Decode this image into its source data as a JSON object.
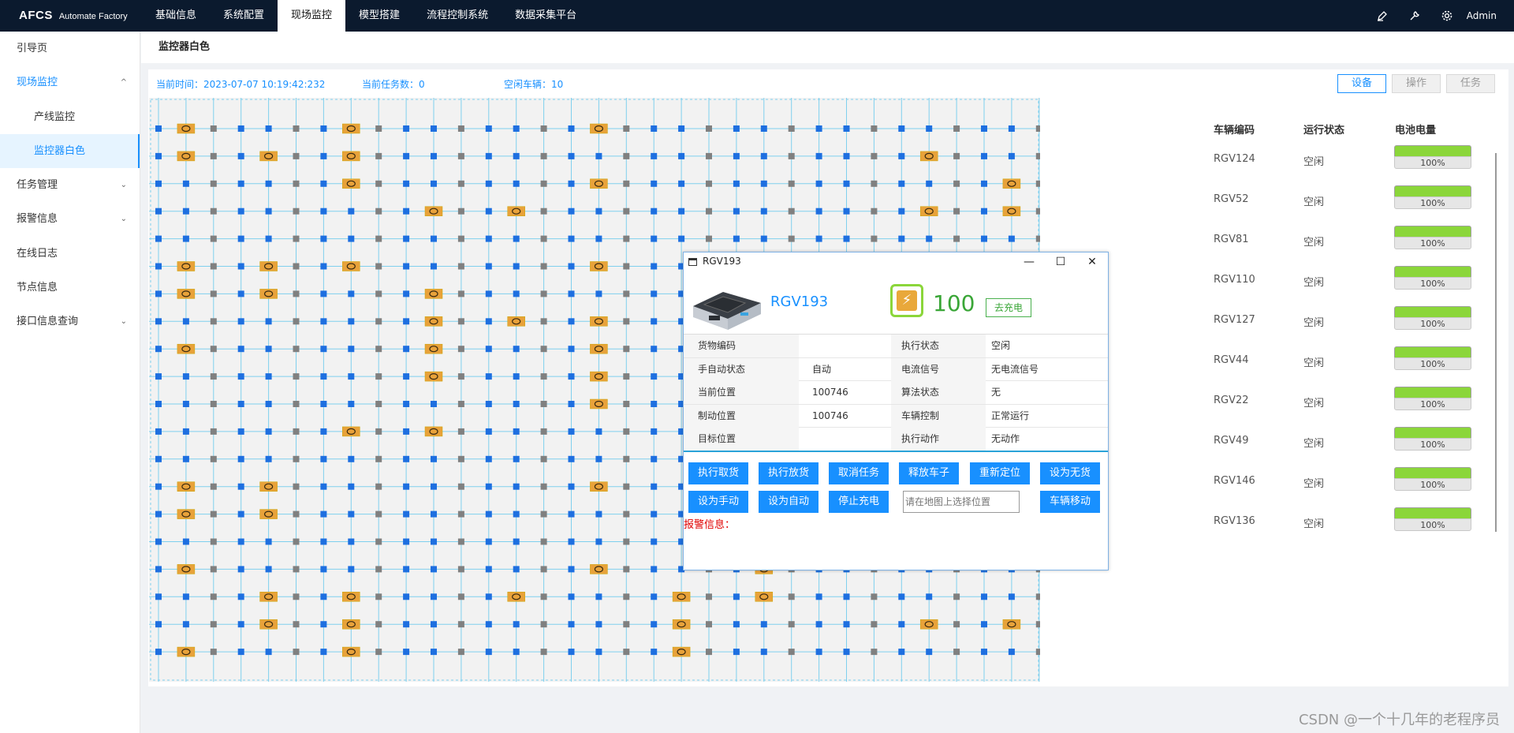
{
  "app": {
    "brand_bold": "AFCS",
    "brand_sub": "Automate Factory",
    "user": "Admin"
  },
  "topnav": [
    "基础信息",
    "系统配置",
    "现场监控",
    "模型搭建",
    "流程控制系统",
    "数据采集平台"
  ],
  "top_icons": [
    "pen-icon",
    "wrench-icon",
    "gear-icon"
  ],
  "sidebar": [
    {
      "label": "引导页"
    },
    {
      "label": "现场监控",
      "chev": "^"
    },
    {
      "label": "产线监控"
    },
    {
      "label": "监控器白色"
    },
    {
      "label": "任务管理",
      "chev": "⌄"
    },
    {
      "label": "报警信息",
      "chev": "⌄"
    },
    {
      "label": "在线日志"
    },
    {
      "label": "节点信息"
    },
    {
      "label": "接口信息查询",
      "chev": "⌄"
    }
  ],
  "page_title": "监控器白色",
  "stats": {
    "time": "当前时间：2023-07-07 10:19:42:232",
    "tasks": "当前任务数：0",
    "idle": "空闲车辆：10"
  },
  "tabs": [
    "设备",
    "操作",
    "任务"
  ],
  "vehicles": {
    "headers": [
      "车辆编码",
      "运行状态",
      "电池电量"
    ],
    "rows": [
      {
        "id": "RGV124",
        "status": "空闲",
        "battery": "100%",
        "level": 1.0
      },
      {
        "id": "RGV52",
        "status": "空闲",
        "battery": "100%",
        "level": 1.0
      },
      {
        "id": "RGV81",
        "status": "空闲",
        "battery": "100%",
        "level": 1.0
      },
      {
        "id": "RGV110",
        "status": "空闲",
        "battery": "100%",
        "level": 1.0
      },
      {
        "id": "RGV127",
        "status": "空闲",
        "battery": "100%",
        "level": 1.0
      },
      {
        "id": "RGV44",
        "status": "空闲",
        "battery": "100%",
        "level": 1.0
      },
      {
        "id": "RGV22",
        "status": "空闲",
        "battery": "100%",
        "level": 1.0
      },
      {
        "id": "RGV49",
        "status": "空闲",
        "battery": "100%",
        "level": 1.0
      },
      {
        "id": "RGV146",
        "status": "空闲",
        "battery": "100%",
        "level": 1.0
      },
      {
        "id": "RGV136",
        "status": "空闲",
        "battery": "100%",
        "level": 1.0
      }
    ]
  },
  "dialog": {
    "title": "RGV193",
    "name": "RGV193",
    "battery": "100",
    "charge_btn": "去充电",
    "rows": [
      [
        "货物编码",
        "",
        "执行状态",
        "空闲"
      ],
      [
        "手自动状态",
        "自动",
        "电流信号",
        "无电流信号"
      ],
      [
        "当前位置",
        "100746",
        "算法状态",
        "无"
      ],
      [
        "制动位置",
        "100746",
        "车辆控制",
        "正常运行"
      ],
      [
        "目标位置",
        "",
        "执行动作",
        "无动作"
      ]
    ],
    "buttons_row1": [
      "执行取货",
      "执行放货",
      "取消任务",
      "释放车子",
      "重新定位",
      "设为无货"
    ],
    "buttons_row2": [
      "设为手动",
      "设为自动",
      "停止充电"
    ],
    "input_placeholder": "请在地图上选择位置",
    "move_btn": "车辆移动",
    "alarm": "报警信息："
  },
  "map": {
    "cols": 33,
    "rows": 20
  },
  "watermark": "CSDN @一个十几年的老程序员",
  "colors": {
    "accent": "#1890ff",
    "topbar": "#0b1a2e",
    "grid_line": "#7fd0ee",
    "node": "#1e6fe0",
    "node_gray": "#808080",
    "cargo": "#e8a23a"
  }
}
